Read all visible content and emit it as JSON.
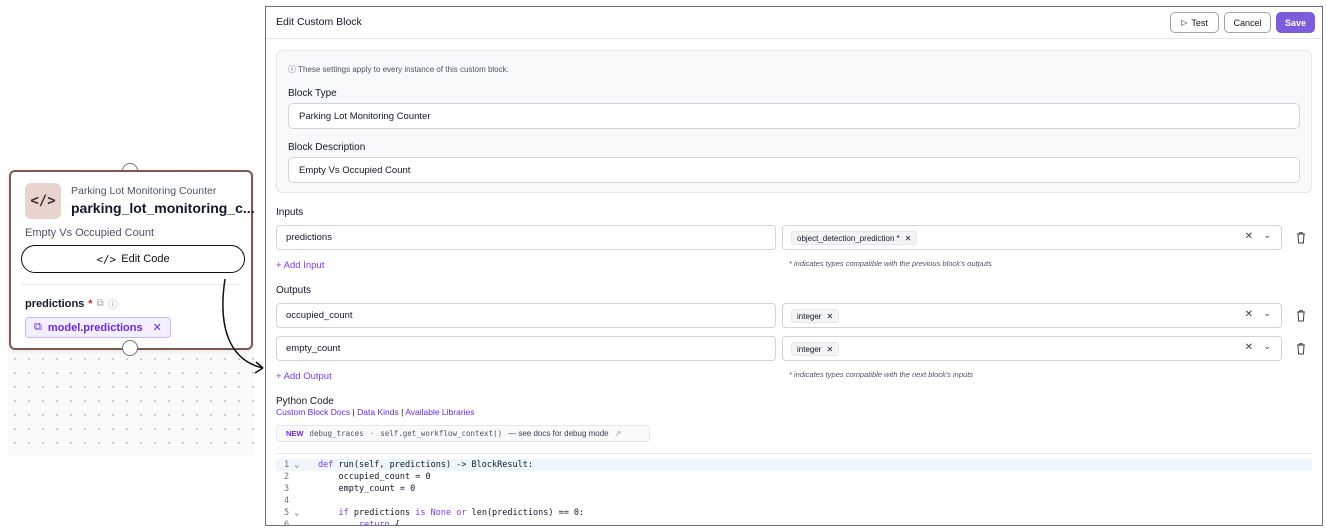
{
  "node": {
    "type_label": "Parking Lot Monitoring Counter",
    "title": "parking_lot_monitoring_c...",
    "description": "Empty Vs Occupied Count",
    "edit_code_label": "Edit Code",
    "input_label": "predictions",
    "required_mark": "*",
    "chip_label": "model.predictions"
  },
  "modal": {
    "title": "Edit Custom Block",
    "buttons": {
      "test": "Test",
      "cancel": "Cancel",
      "save": "Save"
    },
    "info_note": "These settings apply to every instance of this custom block.",
    "block_type_label": "Block Type",
    "block_type_value": "Parking Lot Monitoring Counter",
    "block_description_label": "Block Description",
    "block_description_value": "Empty Vs Occupied Count",
    "inputs_label": "Inputs",
    "inputs": [
      {
        "name": "predictions",
        "type": "object_detection_prediction *"
      }
    ],
    "add_input": "+ Add Input",
    "inputs_hint": "* indicates types compatible with the previous block's outputs",
    "outputs_label": "Outputs",
    "outputs": [
      {
        "name": "occupied_count",
        "type": "integer"
      },
      {
        "name": "empty_count",
        "type": "integer"
      }
    ],
    "add_output": "+ Add Output",
    "outputs_hint": "* indicates types compatible with the next block's inputs",
    "python_label": "Python Code",
    "links": {
      "docs": "Custom Block Docs",
      "kinds": "Data Kinds",
      "libs": "Available Libraries",
      "sep": "|"
    },
    "new_bar": {
      "badge": "NEW",
      "code1": "debug_traces",
      "dot": "·",
      "code2": "self.get_workflow_context()",
      "text": "— see docs for debug mode"
    },
    "code_lines": [
      {
        "n": "1",
        "fold": true
      },
      {
        "n": "2",
        "text": "    occupied_count = 0"
      },
      {
        "n": "3",
        "text": "    empty_count = 0"
      },
      {
        "n": "4",
        "text": ""
      },
      {
        "n": "5",
        "fold": true
      },
      {
        "n": "6",
        "text": ""
      }
    ],
    "code": {
      "l1_def": "def",
      "l1_rest": " run(self, predictions) -> BlockResult:",
      "l5_if": "    if",
      "l5_mid": " predictions ",
      "l5_is": "is",
      "l5_none": " None ",
      "l5_or": "or",
      "l5_rest": " len(predictions) == 0:",
      "l6_return": "        return",
      "l6_rest": " {"
    }
  },
  "colors": {
    "accent": "#7c5cdb",
    "node_border": "#7b5a52",
    "link": "#6d28d9"
  }
}
